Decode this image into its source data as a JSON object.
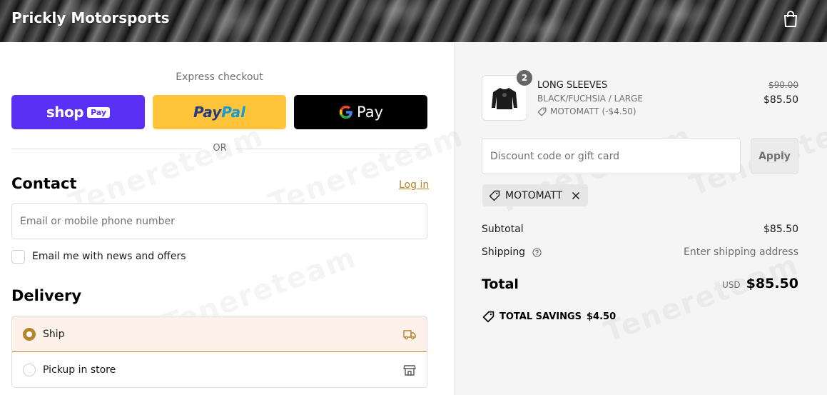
{
  "header": {
    "store_name": "Prickly Motorsports",
    "cart_icon": "shopping-bag-icon"
  },
  "express": {
    "title": "Express checkout",
    "shop_pay": {
      "brand": "shop",
      "badge": "Pay",
      "color": "#5a31f4"
    },
    "paypal": {
      "part1": "Pay",
      "part2": "Pal",
      "color": "#ffc439"
    },
    "gpay": {
      "label": "Pay",
      "color": "#000000"
    },
    "or_label": "OR"
  },
  "contact": {
    "heading": "Contact",
    "login_label": "Log in",
    "email_placeholder": "Email or mobile phone number",
    "newsletter_label": "Email me with news and offers"
  },
  "delivery": {
    "heading": "Delivery",
    "options": [
      {
        "label": "Ship",
        "icon": "truck-icon",
        "selected": true
      },
      {
        "label": "Pickup in store",
        "icon": "store-icon",
        "selected": false
      }
    ]
  },
  "order": {
    "item": {
      "quantity": "2",
      "name": "LONG SLEEVES",
      "variant": "BLACK/FUCHSIA / LARGE",
      "discount": "MOTOMATT (-$4.50)",
      "original_price": "$90.00",
      "price": "$85.50",
      "image": "long-sleeve-shirt-image"
    },
    "discount_placeholder": "Discount code or gift card",
    "apply_label": "Apply",
    "applied_code": "MOTOMATT",
    "subtotal_label": "Subtotal",
    "subtotal_value": "$85.50",
    "shipping_label": "Shipping",
    "shipping_value": "Enter shipping address",
    "total_label": "Total",
    "currency": "USD",
    "total_value": "$85.50",
    "savings_label": "TOTAL SAVINGS",
    "savings_value": "$4.50"
  },
  "theme": {
    "accent": "#b5862a",
    "selected_bg": "#fdf1ea",
    "summary_bg": "#f5f5f5"
  },
  "watermark": "Tenereteam"
}
